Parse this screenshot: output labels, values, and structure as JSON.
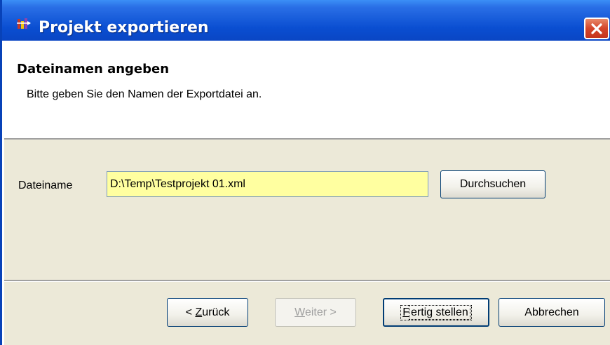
{
  "window": {
    "title": "Projekt exportieren"
  },
  "header": {
    "heading": "Dateinamen angeben",
    "subtitle": "Bitte geben Sie den Namen der Exportdatei an."
  },
  "form": {
    "filename_label": "Dateiname",
    "filename_value": "D:\\Temp\\Testprojekt 01.xml",
    "browse_label": "Durchsuchen"
  },
  "buttons": {
    "back_prefix": "< ",
    "back_mnemonic": "Z",
    "back_rest": "urück",
    "next_mnemonic": "W",
    "next_rest": "eiter >",
    "finish_mnemonic": "F",
    "finish_rest": "ertig stellen",
    "cancel_label": "Abbrechen"
  },
  "colors": {
    "titlebar": "#0a4ed1",
    "input_background": "#ffffa0",
    "dialog_background": "#ece9d8",
    "close_button": "#d4452a"
  },
  "icons": {
    "app": "project-wizard-icon",
    "close": "close-icon"
  }
}
